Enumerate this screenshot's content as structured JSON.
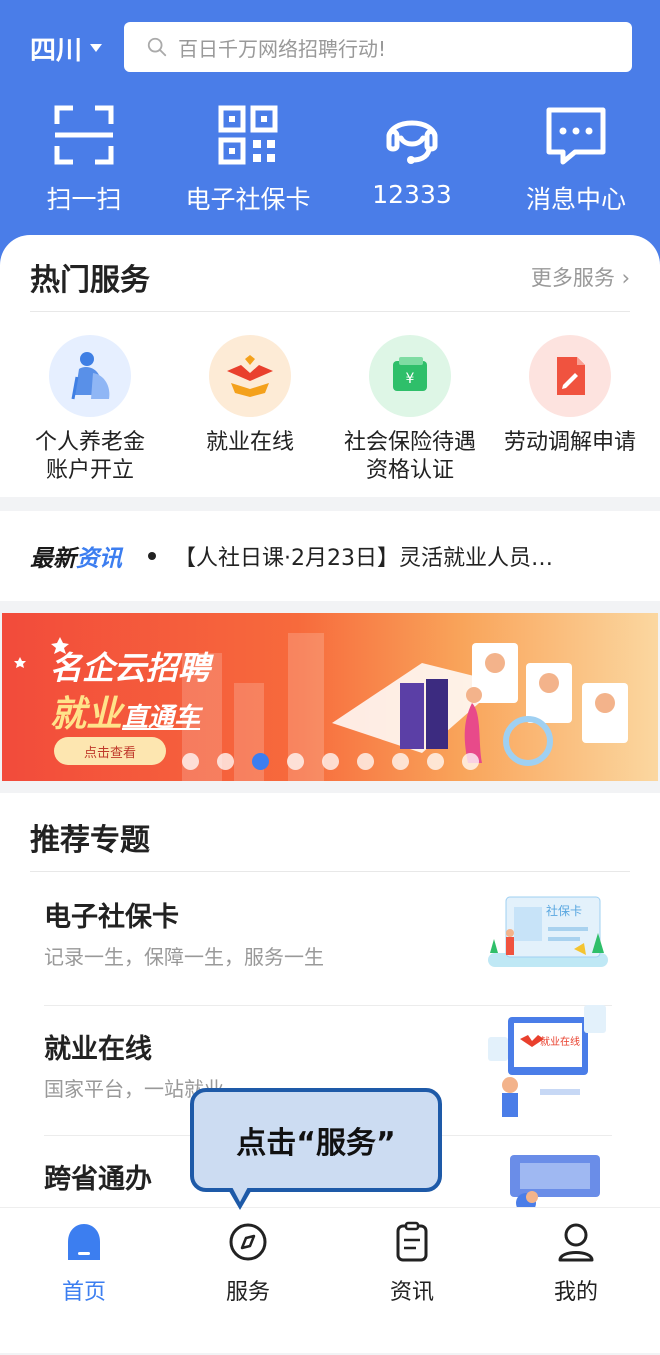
{
  "header": {
    "region": "四川",
    "search_placeholder": "百日千万网络招聘行动!",
    "quick_actions": [
      {
        "label": "扫一扫",
        "icon": "scan-icon"
      },
      {
        "label": "电子社保卡",
        "icon": "qr-code-icon"
      },
      {
        "label": "12333",
        "icon": "headset-icon"
      },
      {
        "label": "消息中心",
        "icon": "message-icon"
      }
    ]
  },
  "hot_services": {
    "title": "热门服务",
    "more": "更多服务 ›",
    "items": [
      {
        "label_line1": "个人养老金",
        "label_line2": "账户开立",
        "icon": "elderly-icon",
        "bg": "#e6efff"
      },
      {
        "label_line1": "就业在线",
        "label_line2": "",
        "icon": "employment-logo-icon",
        "bg": "#fdebd6"
      },
      {
        "label_line1": "社会保险待遇",
        "label_line2": "资格认证",
        "icon": "wallet-icon",
        "bg": "#def6e6"
      },
      {
        "label_line1": "劳动调解申请",
        "label_line2": "",
        "icon": "document-icon",
        "bg": "#fde3df"
      }
    ]
  },
  "news": {
    "tag_part1": "最新",
    "tag_part2": "资讯",
    "headline": "【人社日课·2月23日】灵活就业人员…"
  },
  "banner": {
    "line1": "名企云招聘",
    "line2a": "就业",
    "line2b": "直通车",
    "cta": "点击查看",
    "slide_count": 9,
    "active_slide": 3
  },
  "topics": {
    "title": "推荐专题",
    "items": [
      {
        "name": "电子社保卡",
        "desc": "记录一生，保障一生，服务一生",
        "thumb_text": "社保卡"
      },
      {
        "name": "就业在线",
        "desc": "国家平台，一站就业",
        "thumb_text": "就业在线"
      },
      {
        "name": "跨省通办",
        "desc": "",
        "thumb_text": ""
      }
    ]
  },
  "callout": {
    "text": "点击“服务”"
  },
  "tabbar": {
    "tabs": [
      {
        "label": "首页",
        "icon": "home-icon",
        "active": true
      },
      {
        "label": "服务",
        "icon": "compass-icon",
        "active": false
      },
      {
        "label": "资讯",
        "icon": "news-icon",
        "active": false
      },
      {
        "label": "我的",
        "icon": "profile-icon",
        "active": false
      }
    ]
  },
  "colors": {
    "primary": "#4a7de8",
    "accent": "#3c7ef0",
    "callout_border": "#1e5aa8",
    "callout_bg": "#ccdcf2"
  }
}
